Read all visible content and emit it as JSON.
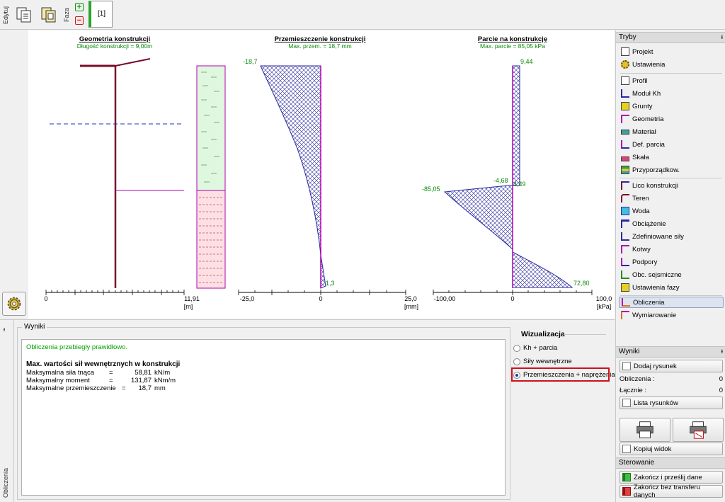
{
  "toolbar": {
    "edit_label": "Edytuj",
    "phase_label": "Faza",
    "phase_add": "+",
    "phase_remove": "−",
    "phase_tab": "[1]"
  },
  "chart_geometry": {
    "title": "Geometria konstrukcji",
    "subtitle": "Długość konstrukcji = 9,00m",
    "axis_ticks": [
      "0",
      "11,91"
    ],
    "unit": "[m]"
  },
  "chart_displacement": {
    "title": "Przemieszczenie konstrukcji",
    "subtitle": "Max. przem. = 18,7 mm",
    "label_top": "-18,7",
    "label_bottom": "1,3",
    "axis_ticks": [
      "-25,0",
      "0",
      "25,0"
    ],
    "unit": "[mm]"
  },
  "chart_pressure": {
    "title": "Parcie na konstrukcję",
    "subtitle": "Max. parcie = 85,05 kPa",
    "label_top": "9,44",
    "label_left": "-85,05",
    "label_mid_left": "-4,68",
    "label_mid_right": "4,49",
    "label_bottom": "72,80",
    "axis_ticks": [
      "-100,00",
      "0",
      "100,0"
    ],
    "unit": "[kPa]"
  },
  "results": {
    "side_label": "Obliczenia",
    "group_title": "Wyniki",
    "status": "Obliczenia przebiegły prawidłowo.",
    "heading": "Max. wartości sił wewnętrznych w konstrukcji",
    "rows": [
      {
        "label": "Maksymalna siła tnąca",
        "eq": "=",
        "value": "58,81",
        "unit": "kN/m"
      },
      {
        "label": "Maksymalny moment",
        "eq": "=",
        "value": "131,87",
        "unit": "kNm/m"
      },
      {
        "label": "Maksymalne przemieszczenie",
        "eq": "=",
        "value": "18,7",
        "unit": "mm"
      }
    ]
  },
  "visualization": {
    "title": "Wizualizacja",
    "options": [
      "Kh + parcia",
      "Siły wewnętrzne",
      "Przemieszczenia + naprężenia"
    ],
    "selected": "Przemieszczenia + naprężenia"
  },
  "right_panel": {
    "modes_title": "Tryby",
    "pin": "ᵻ",
    "group1": [
      "Projekt",
      "Ustawienia"
    ],
    "group2": [
      "Profil",
      "Moduł Kh",
      "Grunty",
      "Geometria",
      "Materiał",
      "Def. parcia",
      "Skała",
      "Przyporządkow."
    ],
    "group3": [
      "Lico konstrukcji",
      "Teren",
      "Woda",
      "Obciążenie",
      "Zdefiniowane siły",
      "Kotwy",
      "Podpory",
      "Obc. sejsmiczne",
      "Ustawienia fazy"
    ],
    "group4": [
      "Obliczenia",
      "Wymiarowanie"
    ],
    "active_item": "Obliczenia",
    "results_title": "Wyniki",
    "add_drawing": "Dodaj rysunek",
    "calc_label": "Obliczenia :",
    "calc_value": "0",
    "total_label": "Łącznie :",
    "total_value": "0",
    "drawings_list": "Lista rysunków",
    "copy_view": "Kopiuj widok",
    "control_title": "Sterowanie",
    "finish_send": "Zakończ i prześlij dane",
    "finish_no_transfer": "Zakończ bez transferu danych"
  },
  "colors": {
    "structure": "#7a0a2a",
    "diagram": "#2a2aa0",
    "label_green": "#0a8a0a",
    "pressure_axis": "#b000b0",
    "soil_upper": "#dff7df",
    "soil_lower": "#fde0e4",
    "highlight": "#d0101a"
  }
}
